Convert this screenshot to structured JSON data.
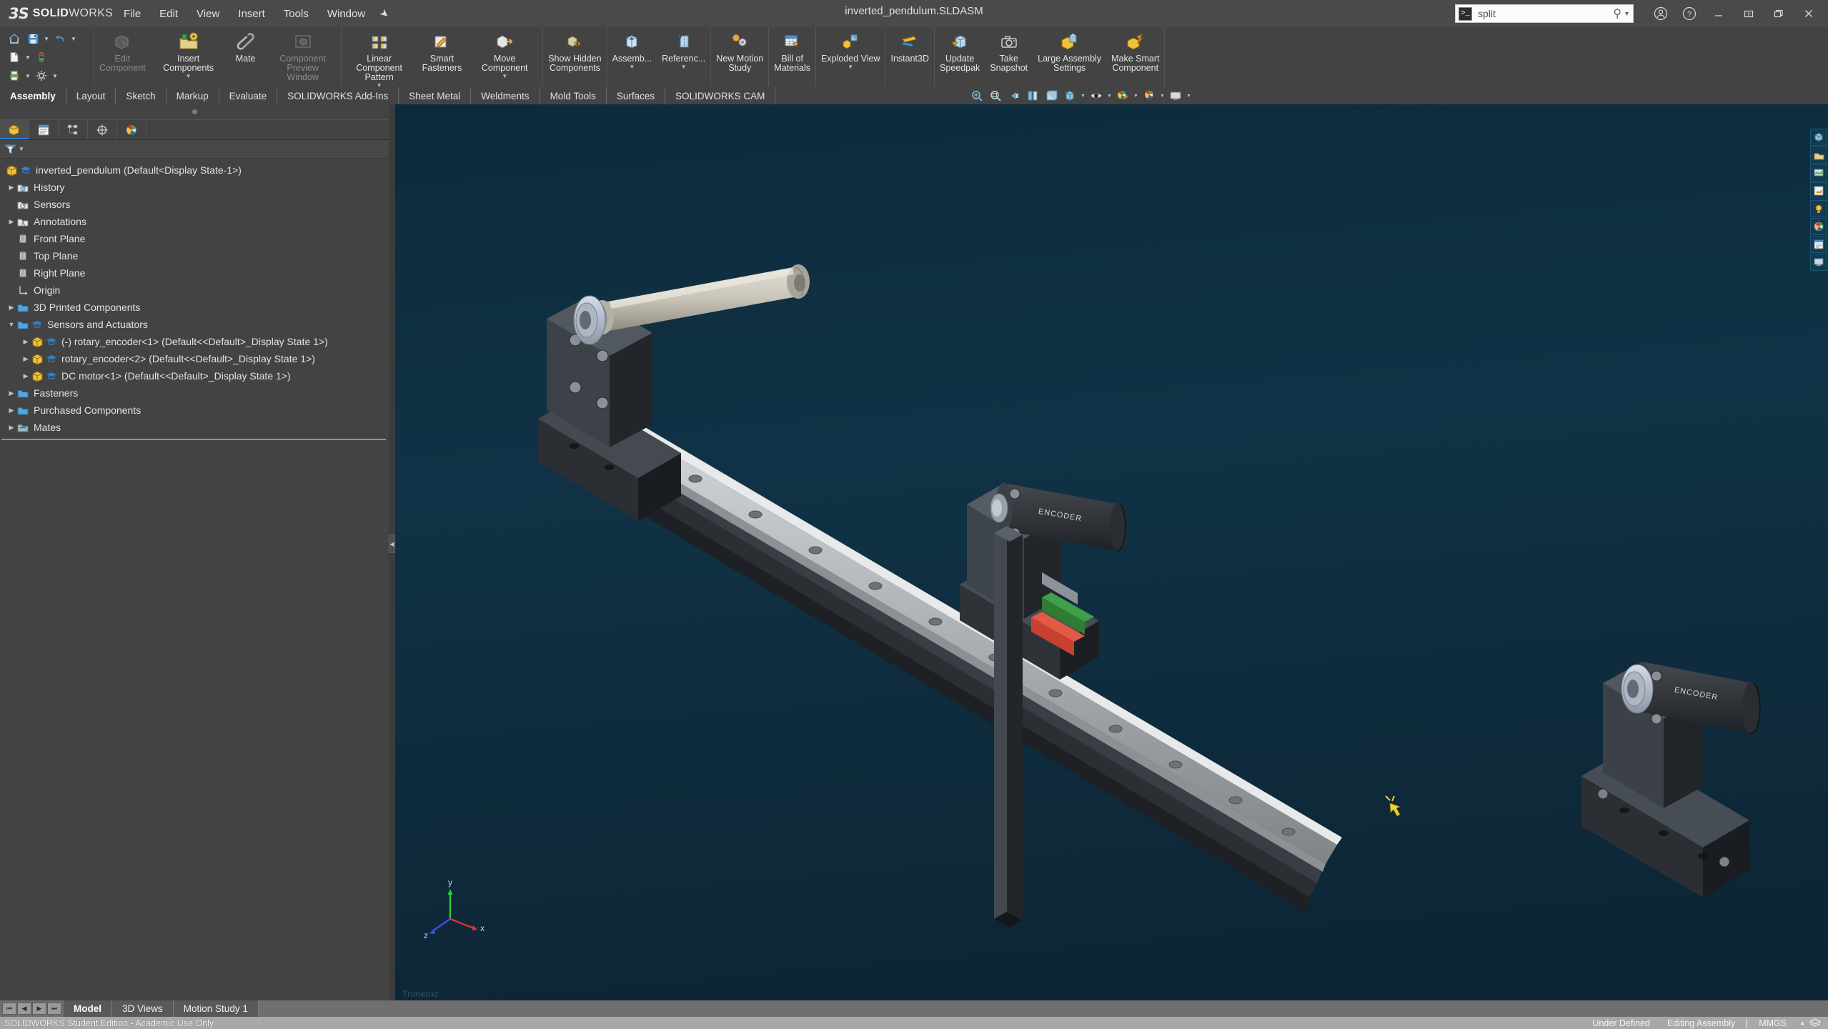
{
  "app": {
    "brand_bold": "SOLID",
    "brand_light": "WORKS",
    "document_title": "inverted_pendulum.SLDASM"
  },
  "menubar": {
    "items": [
      {
        "label": "File"
      },
      {
        "label": "Edit"
      },
      {
        "label": "View"
      },
      {
        "label": "Insert"
      },
      {
        "label": "Tools"
      },
      {
        "label": "Window"
      }
    ],
    "pin_icon": "pin-icon"
  },
  "search": {
    "value": "split",
    "placeholder": "Search",
    "command_icon": "command-prompt-icon",
    "magnifier_icon": "search-icon",
    "caret_icon": "chevron-down-icon"
  },
  "title_buttons": [
    {
      "name": "account-icon",
      "glyph": "ⓘ"
    },
    {
      "name": "help-icon",
      "glyph": "?"
    },
    {
      "name": "minimize-button",
      "glyph": "—"
    },
    {
      "name": "restore-split-button",
      "glyph": "⬌"
    },
    {
      "name": "maximize-button",
      "glyph": "❐"
    },
    {
      "name": "close-button",
      "glyph": "✕"
    }
  ],
  "quick_access": {
    "row1": [
      {
        "name": "home-button",
        "glyph": "home"
      },
      {
        "name": "save-button",
        "glyph": "save"
      },
      {
        "name": "save-caret",
        "glyph": "caret"
      },
      {
        "name": "undo-button",
        "glyph": "undo"
      },
      {
        "name": "undo-caret",
        "glyph": "caret"
      }
    ],
    "row2": [
      {
        "name": "new-document-button",
        "glyph": "doc"
      },
      {
        "name": "new-document-caret",
        "glyph": "caret"
      },
      {
        "name": "rebuild-button",
        "glyph": "traffic"
      }
    ],
    "row3": [
      {
        "name": "print-button",
        "glyph": "print"
      },
      {
        "name": "print-caret",
        "glyph": "caret"
      },
      {
        "name": "options-button",
        "glyph": "gear"
      },
      {
        "name": "options-caret",
        "glyph": "caret"
      }
    ]
  },
  "ribbon": {
    "groups": [
      {
        "commands": [
          {
            "label": "Edit\nComponent",
            "icon": "edit-component-icon",
            "dim": true,
            "caret": false
          },
          {
            "label": "Insert Components",
            "icon": "insert-components-icon",
            "dim": false,
            "caret": true
          },
          {
            "label": "Mate",
            "icon": "mate-icon",
            "dim": false,
            "caret": false
          },
          {
            "label": "Component\nPreview Window",
            "icon": "component-preview-icon",
            "dim": true,
            "caret": false
          }
        ]
      },
      {
        "commands": [
          {
            "label": "Linear Component Pattern",
            "icon": "linear-pattern-icon",
            "dim": false,
            "caret": true
          },
          {
            "label": "Smart\nFasteners",
            "icon": "smart-fasteners-icon",
            "dim": false,
            "caret": false
          },
          {
            "label": "Move Component",
            "icon": "move-component-icon",
            "dim": false,
            "caret": true
          }
        ]
      },
      {
        "commands": [
          {
            "label": "Show Hidden\nComponents",
            "icon": "show-hidden-icon",
            "dim": false,
            "caret": false
          }
        ]
      },
      {
        "commands": [
          {
            "label": "Assemb...",
            "icon": "assembly-features-icon",
            "dim": false,
            "caret": true
          },
          {
            "label": "Referenc...",
            "icon": "reference-geometry-icon",
            "dim": false,
            "caret": true
          }
        ]
      },
      {
        "commands": [
          {
            "label": "New Motion\nStudy",
            "icon": "new-motion-study-icon",
            "dim": false,
            "caret": false
          }
        ]
      },
      {
        "commands": [
          {
            "label": "Bill of\nMaterials",
            "icon": "bill-of-materials-icon",
            "dim": false,
            "caret": false
          }
        ]
      },
      {
        "commands": [
          {
            "label": "Exploded View",
            "icon": "exploded-view-icon",
            "dim": false,
            "caret": true
          }
        ]
      },
      {
        "commands": [
          {
            "label": "Instant3D",
            "icon": "instant3d-icon",
            "dim": false,
            "caret": false
          }
        ]
      },
      {
        "commands": [
          {
            "label": "Update\nSpeedpak",
            "icon": "update-speedpak-icon",
            "dim": false,
            "caret": false
          },
          {
            "label": "Take\nSnapshot",
            "icon": "take-snapshot-icon",
            "dim": false,
            "caret": false
          },
          {
            "label": "Large Assembly\nSettings",
            "icon": "large-assembly-settings-icon",
            "dim": false,
            "caret": false
          },
          {
            "label": "Make Smart\nComponent",
            "icon": "make-smart-component-icon",
            "dim": false,
            "caret": false
          }
        ]
      }
    ]
  },
  "command_tabs": [
    {
      "label": "Assembly",
      "active": true
    },
    {
      "label": "Layout",
      "active": false
    },
    {
      "label": "Sketch",
      "active": false
    },
    {
      "label": "Markup",
      "active": false
    },
    {
      "label": "Evaluate",
      "active": false
    },
    {
      "label": "SOLIDWORKS Add-Ins",
      "active": false
    },
    {
      "label": "Sheet Metal",
      "active": false
    },
    {
      "label": "Weldments",
      "active": false
    },
    {
      "label": "Mold Tools",
      "active": false
    },
    {
      "label": "Surfaces",
      "active": false
    },
    {
      "label": "SOLIDWORKS CAM",
      "active": false
    }
  ],
  "panel_tabs": [
    {
      "name": "feature-manager-tab",
      "icon": "feature-tree-icon",
      "active": true
    },
    {
      "name": "property-manager-tab",
      "icon": "property-list-icon",
      "active": false
    },
    {
      "name": "configuration-manager-tab",
      "icon": "configurations-icon",
      "active": false
    },
    {
      "name": "dimxpert-manager-tab",
      "icon": "dimxpert-icon",
      "active": false
    },
    {
      "name": "display-manager-tab",
      "icon": "appearances-icon",
      "active": false
    }
  ],
  "filter_bar": {
    "icon": "filter-icon",
    "caret": "chevron-down-icon"
  },
  "feature_tree": [
    {
      "label": "inverted_pendulum  (Default<Display State-1>)",
      "icon": "assembly-icon",
      "badge": "student-cap-icon",
      "indent": 0,
      "arrow": "none"
    },
    {
      "label": "History",
      "icon": "history-folder-icon",
      "indent": 1,
      "arrow": "closed"
    },
    {
      "label": "Sensors",
      "icon": "sensors-folder-icon",
      "indent": 1,
      "arrow": "none"
    },
    {
      "label": "Annotations",
      "icon": "annotations-folder-icon",
      "indent": 1,
      "arrow": "closed"
    },
    {
      "label": "Front Plane",
      "icon": "plane-icon",
      "indent": 1,
      "arrow": "none"
    },
    {
      "label": "Top Plane",
      "icon": "plane-icon",
      "indent": 1,
      "arrow": "none"
    },
    {
      "label": "Right Plane",
      "icon": "plane-icon",
      "indent": 1,
      "arrow": "none"
    },
    {
      "label": "Origin",
      "icon": "origin-icon",
      "indent": 1,
      "arrow": "none"
    },
    {
      "label": "3D Printed Components",
      "icon": "folder-icon",
      "indent": 1,
      "arrow": "closed"
    },
    {
      "label": "Sensors and Actuators",
      "icon": "folder-icon",
      "badge": "student-cap-icon",
      "indent": 1,
      "arrow": "open"
    },
    {
      "label": "(-) rotary_encoder<1>  (Default<<Default>_Display State 1>)",
      "icon": "part-icon",
      "badge": "student-cap-icon",
      "indent": 2,
      "arrow": "closed"
    },
    {
      "label": "rotary_encoder<2>  (Default<<Default>_Display State 1>)",
      "icon": "part-icon",
      "badge": "student-cap-icon",
      "indent": 2,
      "arrow": "closed"
    },
    {
      "label": "DC motor<1>  (Default<<Default>_Display State 1>)",
      "icon": "part-icon",
      "badge": "student-cap-icon",
      "indent": 2,
      "arrow": "closed"
    },
    {
      "label": "Fasteners",
      "icon": "folder-icon",
      "indent": 1,
      "arrow": "closed"
    },
    {
      "label": "Purchased Components",
      "icon": "folder-icon",
      "indent": 1,
      "arrow": "closed"
    },
    {
      "label": "Mates",
      "icon": "mates-folder-icon",
      "indent": 1,
      "arrow": "closed"
    }
  ],
  "view_toolbar": [
    {
      "name": "zoom-to-fit-icon",
      "caret": false
    },
    {
      "name": "zoom-to-area-icon",
      "caret": false
    },
    {
      "name": "previous-view-icon",
      "caret": false
    },
    {
      "name": "section-view-icon",
      "caret": false
    },
    {
      "name": "view-orientation-icon",
      "caret": false
    },
    {
      "name": "display-style-icon",
      "caret": true
    },
    {
      "name": "hide-show-items-icon",
      "caret": true
    },
    {
      "name": "edit-appearance-icon",
      "caret": true
    },
    {
      "name": "apply-scene-icon",
      "caret": true
    },
    {
      "name": "view-settings-icon",
      "caret": true
    }
  ],
  "right_rail": [
    {
      "name": "view-orientation-cube-icon"
    },
    {
      "name": "appearances-rail-icon"
    },
    {
      "name": "scenes-rail-icon"
    },
    {
      "name": "decals-rail-icon"
    },
    {
      "name": "lights-rail-icon"
    },
    {
      "name": "cameras-rail-icon"
    },
    {
      "name": "display-states-rail-icon"
    },
    {
      "name": "custom-view-rail-icon"
    }
  ],
  "triad": {
    "x_label": "x",
    "y_label": "y",
    "z_label": "z"
  },
  "graphics_watermark": "Trimetric",
  "bottom_tabs": [
    {
      "label": "Model",
      "active": true
    },
    {
      "label": "3D Views",
      "active": false
    },
    {
      "label": "Motion Study 1",
      "active": false
    }
  ],
  "nav_buttons": [
    {
      "name": "first-tab-button",
      "glyph": "❘◀"
    },
    {
      "name": "previous-tab-button",
      "glyph": "◀"
    },
    {
      "name": "next-tab-button",
      "glyph": "▶"
    },
    {
      "name": "last-tab-button",
      "glyph": "▶❘"
    }
  ],
  "status_bar": {
    "license": "SOLIDWORKS Student Edition - Academic Use Only",
    "state": "Under Defined",
    "mode": "Editing Assembly",
    "units": "MMGS",
    "units_caret": "chevron-up-icon",
    "overlay_icon": "overlay-icon"
  },
  "colors": {
    "accent_blue": "#2b7fd4",
    "graphics_bg": "#0f3044",
    "chrome": "#434343",
    "titlebar": "#4a4a4a",
    "status_bg": "#a8a8a8"
  }
}
